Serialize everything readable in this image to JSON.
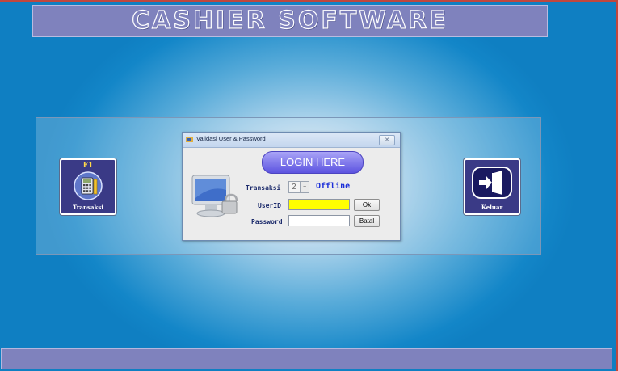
{
  "app": {
    "title": "CASHIER  SOFTWARE"
  },
  "tiles": {
    "transaksi": {
      "label": "Transaksi",
      "hotkey": "F1",
      "icon": "calculator-icon"
    },
    "keluar": {
      "label": "Keluar",
      "icon": "exit-door-icon"
    }
  },
  "dialog": {
    "title": "Validasi User & Password",
    "header_button": "LOGIN HERE",
    "transaksi_label": "Transaksi",
    "transaksi_value": "2",
    "status": "Offline",
    "userid_label": "UserID",
    "userid_value": "",
    "password_label": "Password",
    "password_value": "",
    "ok_label": "Ok",
    "batal_label": "Batal",
    "close_icon": "close-icon"
  },
  "colors": {
    "title_bar": "#7f82bd",
    "tile_bg": "#3a3a86",
    "userid_bg": "#ffff00",
    "status": "#1c2fd8"
  }
}
